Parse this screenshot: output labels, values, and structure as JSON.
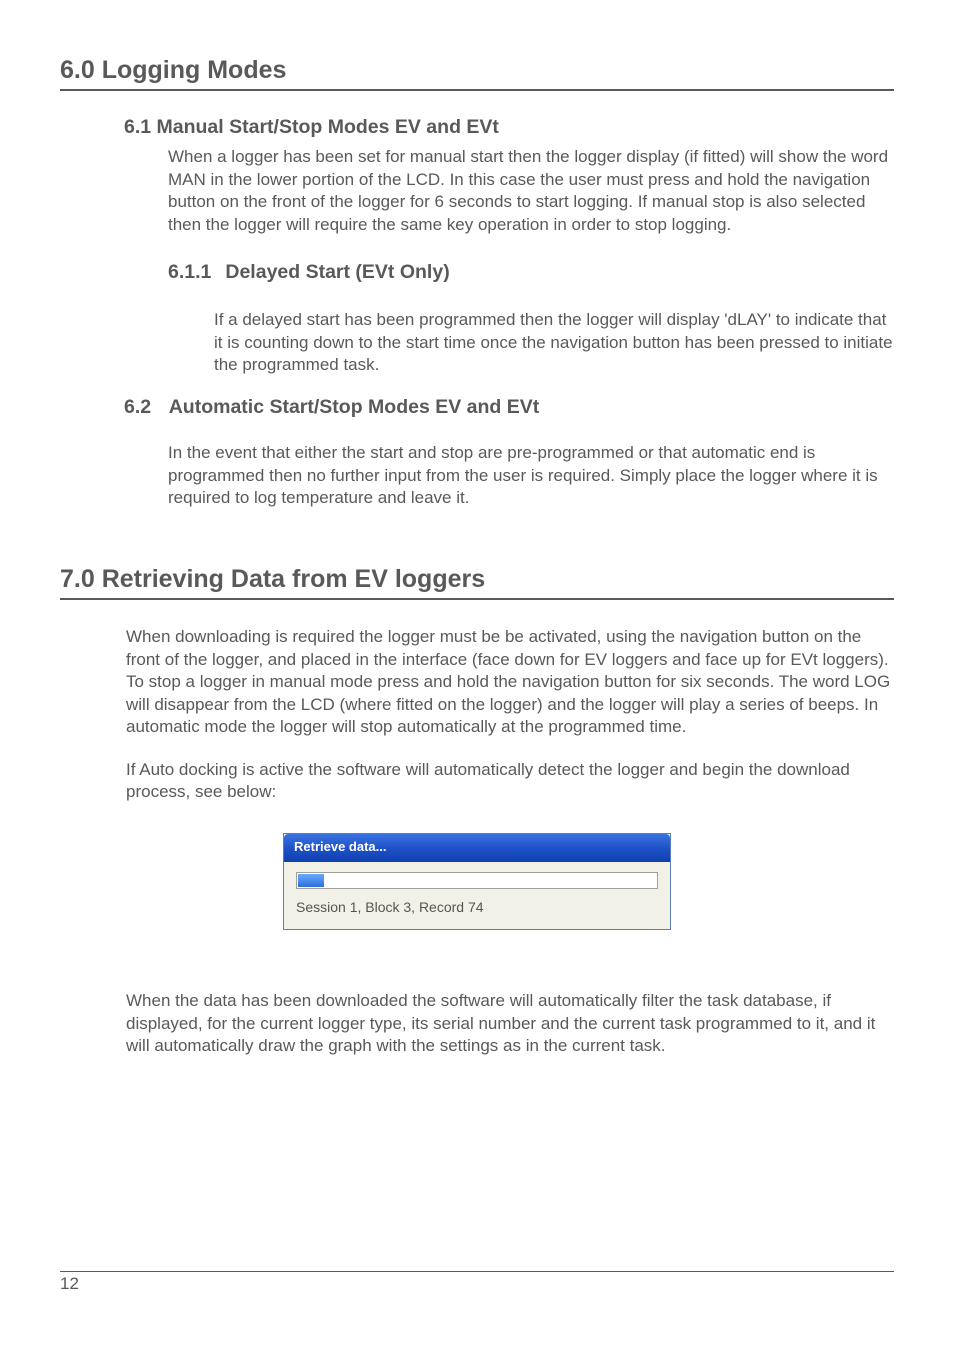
{
  "section6": {
    "title": "6.0 Logging Modes",
    "s61": {
      "title": "6.1 Manual Start/Stop Modes EV and EVt",
      "body": "When a logger has been set for manual start then the logger display (if fitted) will show the word MAN in the lower portion of the LCD. In this case the user must press and hold the navigation button on the front of the logger for 6 seconds to start logging. If manual stop is also selected then the logger will require the same key operation in order to stop logging."
    },
    "s611": {
      "num": "6.1.1",
      "title": "Delayed Start (EVt Only)",
      "body": "If a delayed start has been programmed then the logger will display 'dLAY' to indicate that it is counting down to the start time once the navigation button has been pressed to initiate the programmed task."
    },
    "s62": {
      "num": "6.2",
      "title": "Automatic Start/Stop Modes EV and EVt",
      "body": "In the event that either the start and stop are pre-programmed or that automatic end is programmed then no further input from the user is required. Simply place the logger where it is required to log temperature and leave it."
    }
  },
  "section7": {
    "title": "7.0 Retrieving Data from EV loggers",
    "p1": "When downloading is required the logger must be be activated, using the navigation button on the front of the logger, and placed in the interface (face down for EV loggers and face up for EVt loggers). To stop a logger in manual mode press and hold the navigation button for six seconds. The word LOG will disappear from the LCD (where fitted on the logger) and the logger will play a series of beeps. In automatic mode the logger will stop automatically at the programmed time.",
    "p2": "If Auto docking is active the software will automatically detect the logger and begin the download process, see below:",
    "dialog": {
      "title": "Retrieve data...",
      "status": "Session 1, Block 3, Record 74"
    },
    "p3": "When the data has been downloaded the software will automatically filter the task database, if displayed, for the current logger type, its serial number and the current task programmed to it, and it will automatically draw the graph with the settings as in the current task."
  },
  "page": "12"
}
